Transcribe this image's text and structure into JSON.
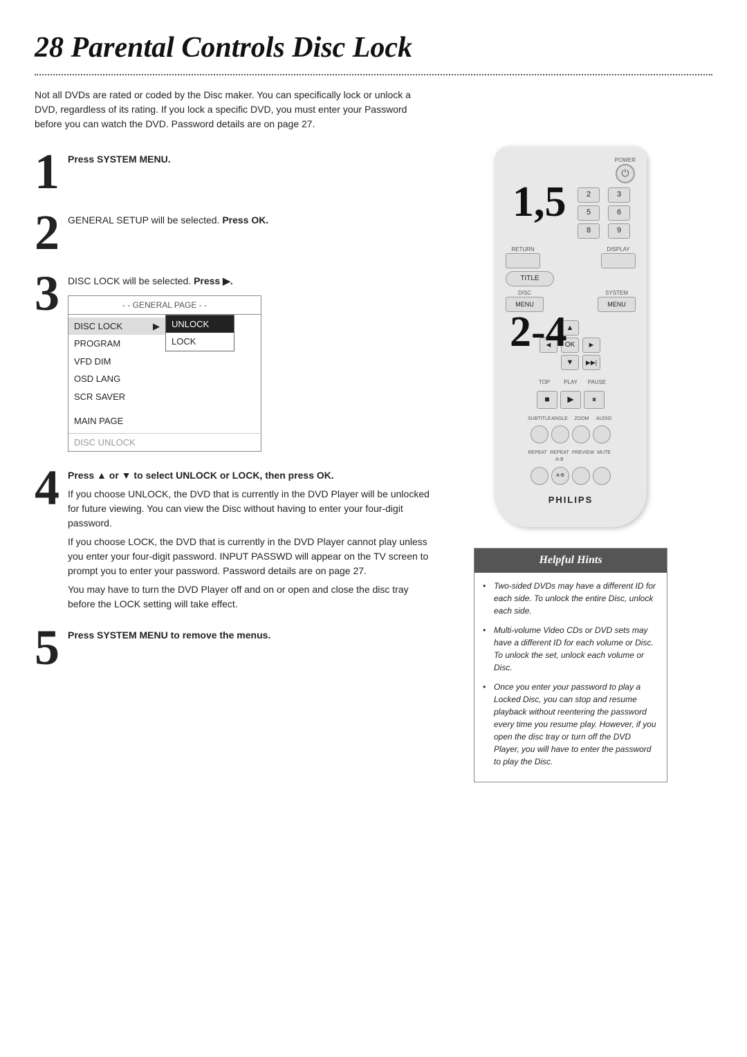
{
  "page": {
    "title": "28  Parental Controls Disc Lock",
    "intro": "Not all DVDs are rated or coded by the Disc maker. You can specifically lock or unlock a DVD, regardless of its rating. If you lock a specific DVD, you must enter your Password before you can watch the DVD. Password details are on page 27."
  },
  "steps": {
    "step1": {
      "number": "1",
      "text_bold": "Press SYSTEM MENU."
    },
    "step2": {
      "number": "2",
      "text_pre": "GENERAL SETUP will be selected. ",
      "text_bold": "Press OK."
    },
    "step3": {
      "number": "3",
      "text_pre": "DISC LOCK will be selected. ",
      "text_bold": "Press ▶."
    },
    "step4": {
      "number": "4",
      "text_bold": "Press ▲ or ▼ to select UNLOCK or LOCK, then press OK.",
      "para1": "If you choose UNLOCK, the DVD that is currently in the DVD Player will be unlocked for future viewing. You can view the Disc without having to enter your four-digit password.",
      "para2": "If you choose LOCK, the DVD that is currently in the DVD Player cannot play unless you enter your four-digit password. INPUT PASSWD will appear on the TV screen to prompt you to enter your password. Password details are on page 27.",
      "para3": "You may have to turn the DVD Player off and on or open and close the disc tray before the LOCK setting will take effect."
    },
    "step5": {
      "number": "5",
      "text_bold": "Press SYSTEM MENU to remove the menus."
    }
  },
  "menu": {
    "header": "- - GENERAL PAGE - -",
    "items": [
      {
        "label": "DISC LOCK",
        "selected": true,
        "has_arrow": true
      },
      {
        "label": "PROGRAM",
        "selected": false
      },
      {
        "label": "VFD DIM",
        "selected": false
      },
      {
        "label": "OSD LANG",
        "selected": false
      },
      {
        "label": "SCR SAVER",
        "selected": false
      }
    ],
    "main_page": "MAIN PAGE",
    "disc_unlock": "DISC UNLOCK",
    "submenu": [
      {
        "label": "UNLOCK",
        "selected": true
      },
      {
        "label": "LOCK",
        "selected": false
      }
    ]
  },
  "remote": {
    "power_icon": "⏻",
    "numbers": [
      "2",
      "3",
      "5",
      "6",
      "8",
      "9"
    ],
    "big_label_top": "1,5",
    "big_label_bottom": "2-4",
    "buttons": {
      "return": "RETURN",
      "title": "TITLE",
      "display": "DISPLAY",
      "disc_menu": "DISC\nMENU",
      "system_menu": "SYSTEM\nMENU",
      "ok": "OK",
      "left": "◄",
      "right": "►",
      "up": "▲",
      "down": "▼",
      "skip_forward": "▶▶|",
      "stop": "■",
      "play": "▶",
      "pause": "⏸",
      "top": "TOP",
      "play_label": "PLAY",
      "pause_label": "PAUSE",
      "subtitle": "SUBTITLE",
      "angle": "ANGLE",
      "zoom": "ZOOM",
      "audio": "AUDIO",
      "repeat": "REPEAT",
      "repeat_ab": "A-B",
      "preview": "PREVIEW",
      "mute": "MUTE"
    },
    "brand": "PHILIPS"
  },
  "helpful_hints": {
    "title": "Helpful Hints",
    "hints": [
      "Two-sided DVDs may have a different ID for each side. To unlock the entire Disc, unlock each side.",
      "Multi-volume Video CDs or DVD sets may have a different ID for each volume or Disc. To unlock the set, unlock each volume or Disc.",
      "Once you enter your password to play a Locked Disc, you can stop and resume playback without reentering the password every time you resume play. However, if you open the disc tray or turn off the DVD Player, you will have to enter the password to play the Disc."
    ]
  }
}
